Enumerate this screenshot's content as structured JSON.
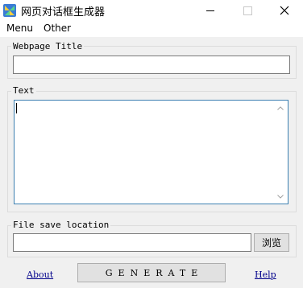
{
  "window": {
    "title": "网页对话框生成器",
    "icon": "app-icon",
    "buttons": [
      "minimize-icon",
      "maximize-icon",
      "close-icon"
    ]
  },
  "menubar": {
    "items": [
      {
        "label": "Menu"
      },
      {
        "label": "Other"
      }
    ]
  },
  "webpage_title": {
    "group_label": "Webpage Title",
    "value": ""
  },
  "text": {
    "group_label": "Text",
    "value": ""
  },
  "file_save": {
    "group_label": "File save location",
    "value": "",
    "browse_label": "浏览"
  },
  "footer": {
    "about_label": "About",
    "generate_label": "GENERATE",
    "help_label": "Help"
  },
  "colors": {
    "link": "#00008b",
    "textarea_border": "#3c7fb1",
    "window_bg": "#f0f0f0"
  }
}
